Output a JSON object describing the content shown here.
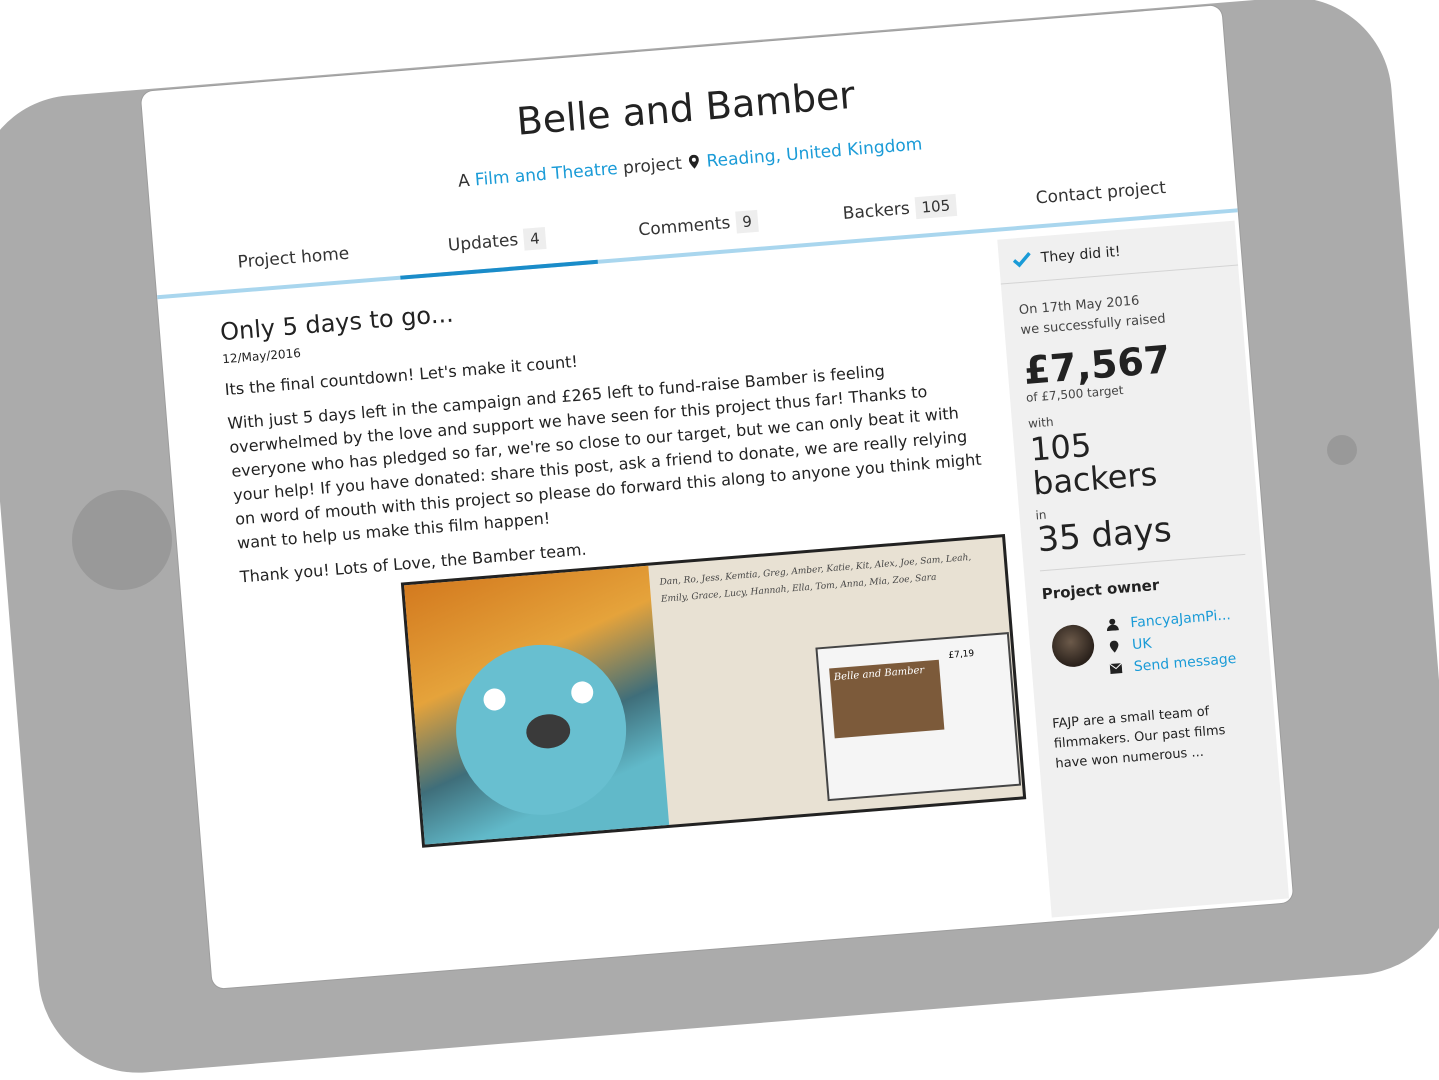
{
  "project": {
    "title": "Belle and Bamber",
    "subtitle_prefix": "A",
    "category": "Film and Theatre",
    "subtitle_mid": "project",
    "location": "Reading, United Kingdom"
  },
  "tabs": [
    {
      "label": "Project home",
      "count": null
    },
    {
      "label": "Updates",
      "count": "4",
      "active": true
    },
    {
      "label": "Comments",
      "count": "9"
    },
    {
      "label": "Backers",
      "count": "105"
    },
    {
      "label": "Contact project",
      "count": null
    }
  ],
  "post": {
    "title": "Only 5 days to go...",
    "date": "12/May/2016",
    "paragraphs": [
      "Its the final countdown! Let's make it count!",
      "With just 5 days left in the campaign and £265 left to fund-raise Bamber is feeling overwhelmed by the love and support we have seen for this project thus far! Thanks to everyone who has pledged so far, we're so close to our target, but we can only beat it with your help! If you have donated: share this post, ask a friend to donate, we are really relying on word of mouth with this project so please do forward this along to anyone you think might want to help us make this film happen!",
      "Thank you! Lots of Love, the Bamber team."
    ],
    "image_note": "Dan, Ro, Jess, Kemtia, Greg, Amber, Katie, Kit, Alex, Joe, Sam, Leah, Emily, Grace, Lucy, Hannah, Ella, Tom, Anna, Mia, Zoe, Sara",
    "image_banner": "Belle and Bamber",
    "image_amount": "£7,19"
  },
  "sidebar": {
    "status": "They did it!",
    "raised_date_line": "On 17th May 2016",
    "raised_line": "we successfully raised",
    "amount": "£7,567",
    "target": "of £7,500 target",
    "with_label": "with",
    "backers_count": "105",
    "backers_label": "backers",
    "in_label": "in",
    "days": "35 days",
    "owner_title": "Project owner",
    "owner_name": "FancyaJamPi...",
    "owner_location": "UK",
    "send_message": "Send message",
    "owner_description": "FAJP are a small team of filmmakers. Our past films have won numerous ..."
  },
  "colors": {
    "accent": "#1a9bd7",
    "tab_underline": "#a9d6ee",
    "tab_active": "#1a8cc9",
    "tablet_frame": "#ababab"
  }
}
